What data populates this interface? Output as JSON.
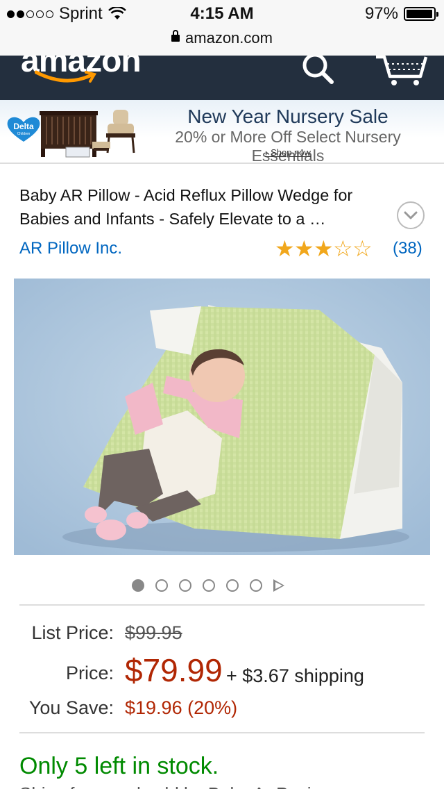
{
  "status_bar": {
    "carrier": "Sprint",
    "time": "4:15 AM",
    "battery": "97%",
    "battery_level": 0.97,
    "signal_bars_filled": 2,
    "signal_bars_total": 5
  },
  "url_bar": {
    "domain": "amazon.com"
  },
  "nav": {
    "logo_text": "amazon",
    "brand_color": "#232f3e",
    "accent_color": "#ff9900"
  },
  "banner": {
    "logo_text": "Delta",
    "logo_subtext": "Children",
    "title": "New Year Nursery Sale",
    "subtitle": "20% or More Off Select Nursery Essentials",
    "link": "Shop now"
  },
  "product": {
    "title": "Baby AR Pillow - Acid Reflux Pillow Wedge for Babies and Infants - Safely Elevate to a …",
    "brand": "AR Pillow Inc.",
    "rating_stars": 3,
    "rating_max": 5,
    "review_count": "(38)",
    "image_count": 6,
    "image_index": 1
  },
  "pricing": {
    "list_label": "List Price:",
    "list_price": "$99.95",
    "price_label": "Price:",
    "price": "$79.99",
    "shipping": "+ $3.67 shipping",
    "save_label": "You Save:",
    "save_value": "$19.96 (20%)",
    "price_color": "#b12704"
  },
  "stock": {
    "message": "Only 5 left in stock.",
    "stock_color": "#008a00",
    "next_line": "Ships from and sold by Baby Ar Pasi..."
  }
}
